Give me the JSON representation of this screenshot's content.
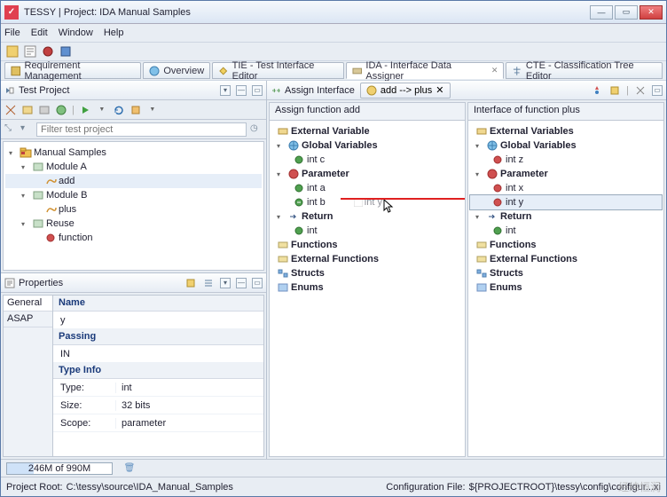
{
  "window": {
    "title": "TESSY | Project: IDA Manual Samples"
  },
  "menu": {
    "file": "File",
    "edit": "Edit",
    "window": "Window",
    "help": "Help"
  },
  "tabs": {
    "req": "Requirement Management",
    "ov": "Overview",
    "tie": "TIE - Test Interface Editor",
    "ida": "IDA - Interface Data Assigner",
    "cte": "CTE - Classification Tree Editor"
  },
  "testProject": {
    "title": "Test Project",
    "filterPlaceholder": "Filter test project",
    "tree": {
      "root": "Manual Samples",
      "moduleA": "Module A",
      "add": "add",
      "moduleB": "Module B",
      "plus": "plus",
      "reuse": "Reuse",
      "function": "function"
    }
  },
  "properties": {
    "title": "Properties",
    "tabs": {
      "general": "General",
      "asap": "ASAP"
    },
    "sections": {
      "name": "Name",
      "nameVal": "y",
      "passing": "Passing",
      "passingVal": "IN",
      "typeinfo": "Type Info",
      "type": "Type:",
      "typeVal": "int",
      "size": "Size:",
      "sizeVal": "32 bits",
      "scope": "Scope:",
      "scopeVal": "parameter"
    }
  },
  "assign": {
    "title": "Assign Interface",
    "crumb": "add --> plus",
    "leftHdr": "Assign function add",
    "rightHdr": "Interface of function plus",
    "left": {
      "extvar": "External Variable",
      "globals": "Global Variables",
      "intc": "int c",
      "param": "Parameter",
      "inta": "int a",
      "intb": "int b",
      "ret": "Return",
      "int": "int",
      "funcs": "Functions",
      "extfuncs": "External Functions",
      "structs": "Structs",
      "enums": "Enums",
      "drag": "int y"
    },
    "right": {
      "extvar": "External Variables",
      "globals": "Global Variables",
      "intz": "int z",
      "param": "Parameter",
      "intx": "int x",
      "inty": "int y",
      "ret": "Return",
      "int": "int",
      "funcs": "Functions",
      "extfuncs": "External Functions",
      "structs": "Structs",
      "enums": "Enums"
    }
  },
  "status": {
    "memory": "246M of 990M",
    "rootLabel": "Project Root:",
    "rootVal": "C:\\tessy\\source\\IDA_Manual_Samples",
    "cfgLabel": "Configuration File:",
    "cfgVal": "${PROJECTROOT}\\tessy\\config\\configur...xi",
    "watermark": "经纬恒润"
  }
}
